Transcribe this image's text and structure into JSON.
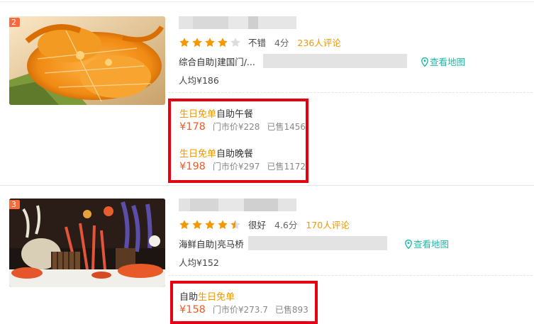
{
  "listings": [
    {
      "rank": "2",
      "rating": {
        "stars_filled": 4,
        "stars_total": 5,
        "label": "不错",
        "score": "4分",
        "reviews": "236人评论"
      },
      "category": "综合自助|建国门/...",
      "map_link": "查看地图",
      "avg_price": "人均¥186",
      "deals": [
        {
          "highlight": "生日免单",
          "name": "自助午餐",
          "price": "¥178",
          "market": "门市价¥228",
          "sold": "已售1456"
        },
        {
          "highlight": "生日免单",
          "name": "自助晚餐",
          "price": "¥198",
          "market": "门市价¥297",
          "sold": "已售1172"
        }
      ]
    },
    {
      "rank": "3",
      "rating": {
        "stars_filled": 4.5,
        "stars_total": 5,
        "label": "很好",
        "score": "4.6分",
        "reviews": "170人评论"
      },
      "category": "海鲜自助|亮马桥",
      "map_link": "查看地图",
      "avg_price": "人均¥152",
      "deals": [
        {
          "prefix": "自助",
          "highlight": "生日免单",
          "price": "¥158",
          "market": "门市价¥273.7",
          "sold": "已售893"
        }
      ]
    }
  ],
  "colors": {
    "accent": "#f39800",
    "price": "#f05a28",
    "highlight_box": "#e60012",
    "map": "#1fb7a6",
    "rank_badge": "#ff6a3d"
  },
  "icons": [
    "star-icon",
    "map-pin-icon"
  ]
}
